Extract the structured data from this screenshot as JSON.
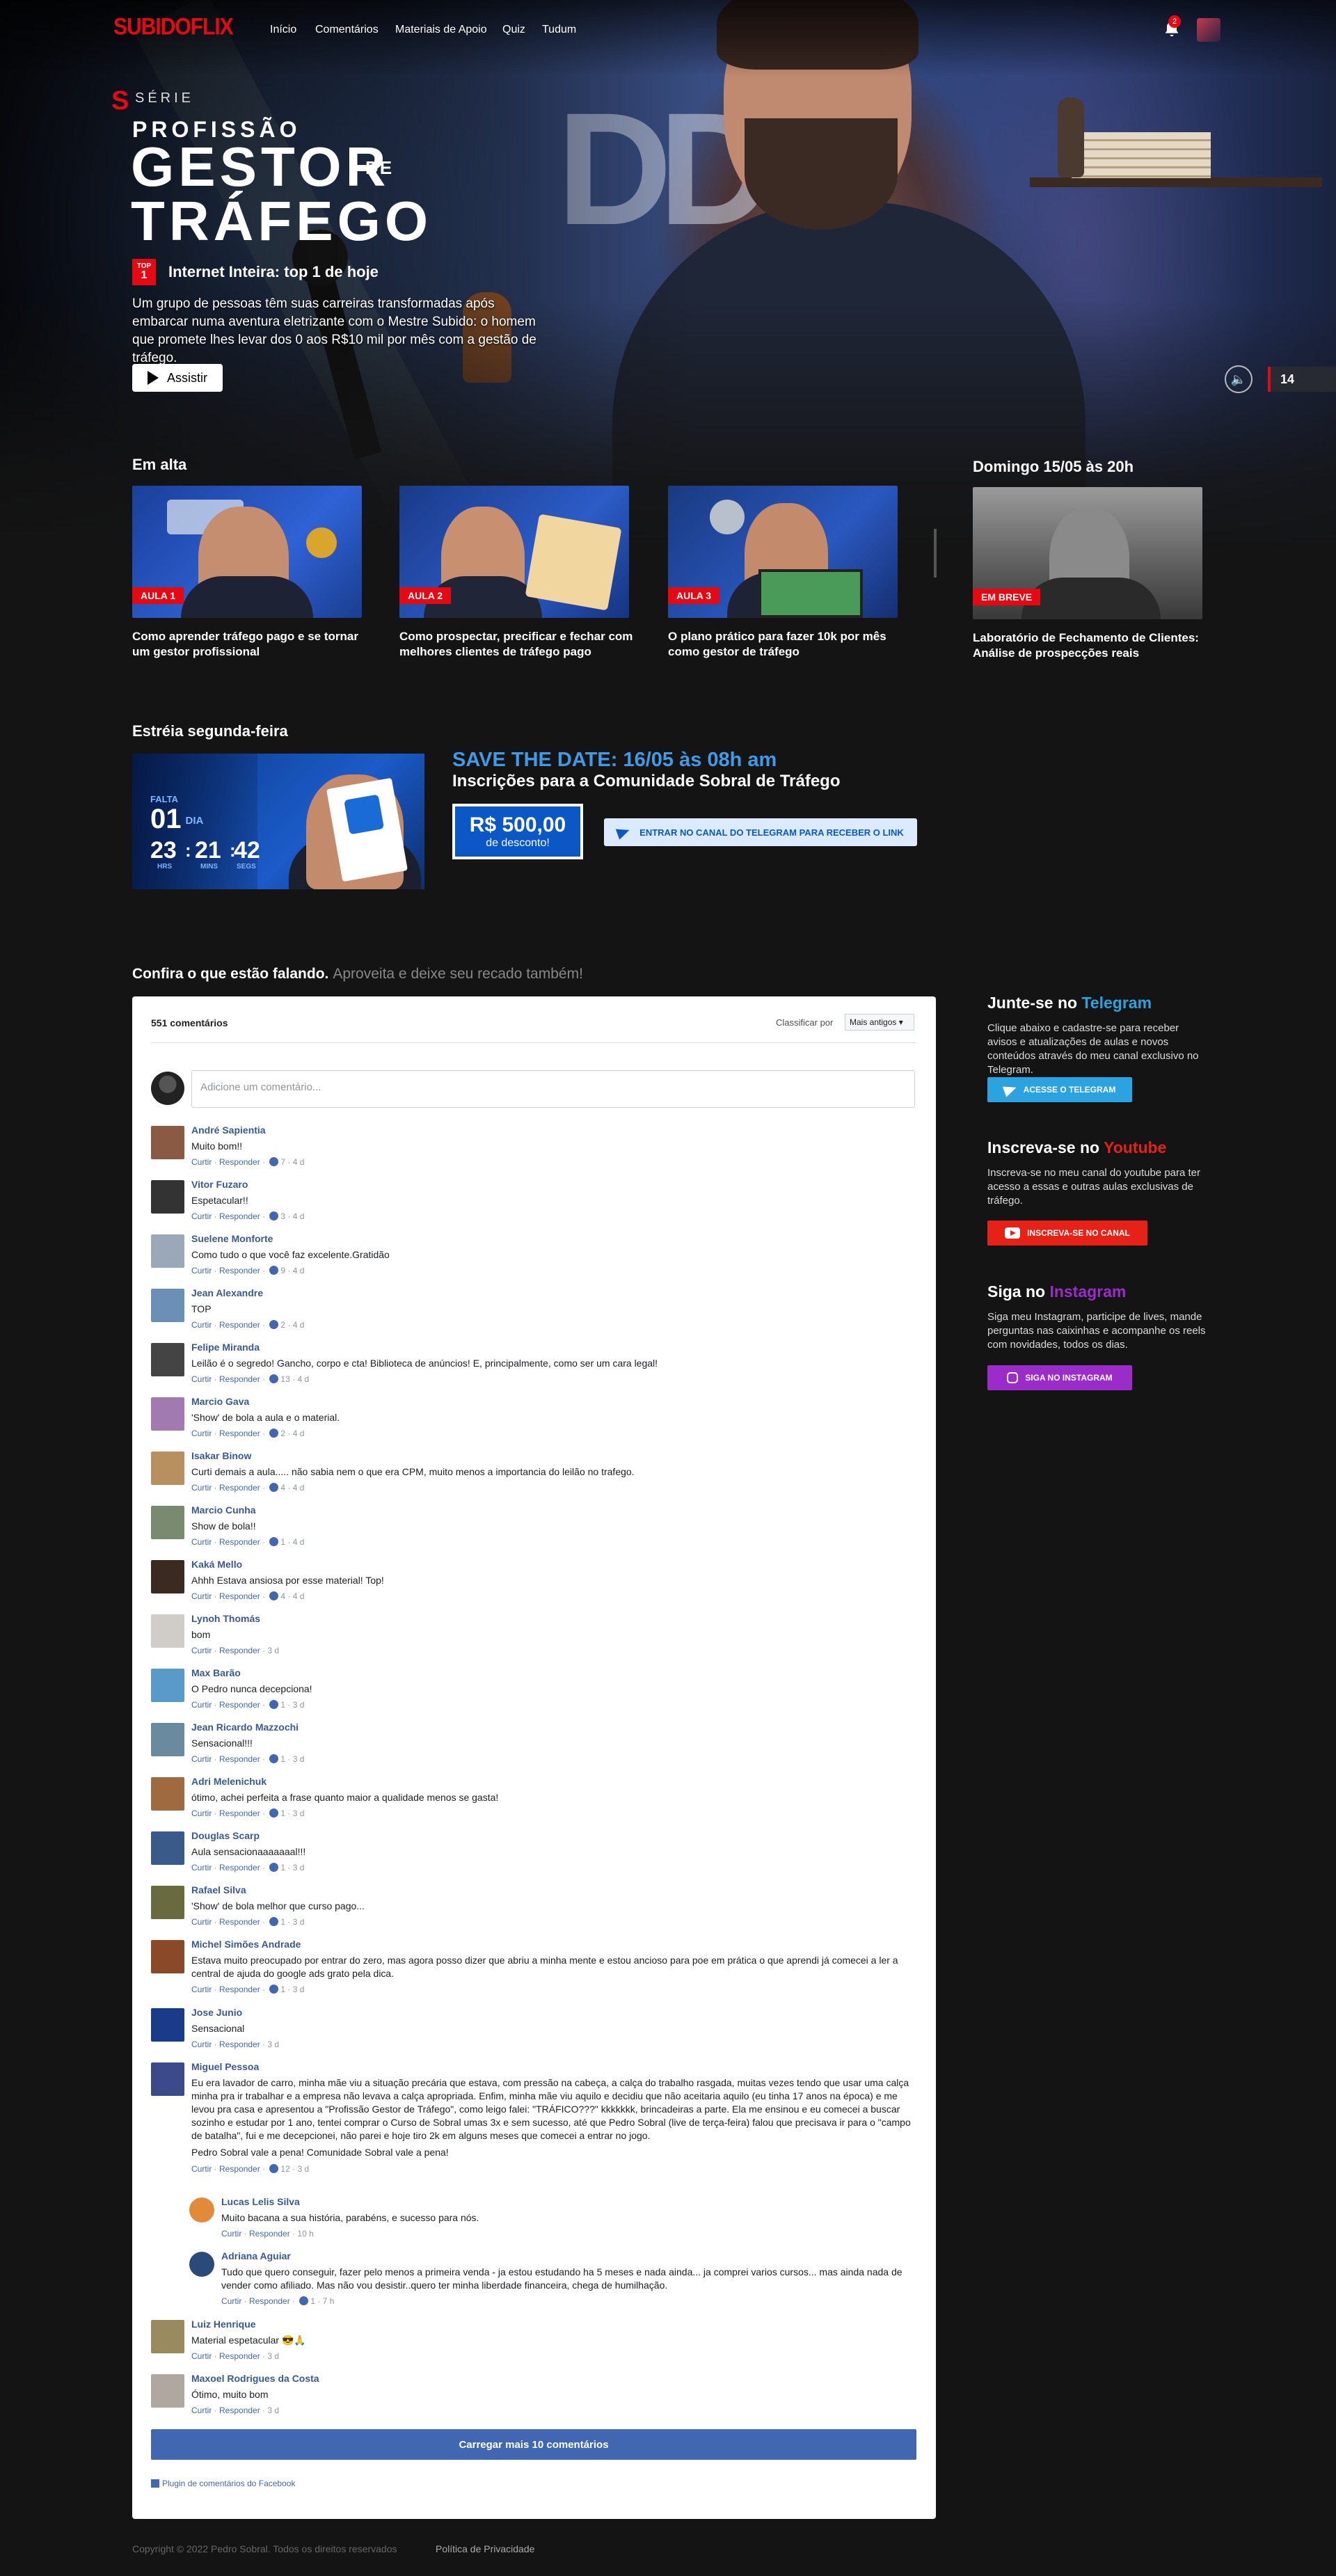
{
  "nav": {
    "logo": "SUBIDOFLIX",
    "links": [
      "Início",
      "Comentários",
      "Materiais de Apoio",
      "Quiz",
      "Tudum"
    ],
    "notifications": "2"
  },
  "hero": {
    "serie": "SÉRIE",
    "title_line1": "PROFISSÃO",
    "title_line2": "GESTOR",
    "title_de": "DE",
    "title_line3": "TRÁFEGO",
    "top_badge_top": "TOP",
    "top_badge_num": "1",
    "top_text": "Internet Inteira: top 1 de hoje",
    "synopsis": "Um grupo de pessoas têm suas carreiras transformadas após embarcar numa aventura eletrizante com o Mestre Subido: o homem que promete lhes levar dos 0 aos R$10 mil por mês com a gestão de tráfego.",
    "watch": "Assistir",
    "age": "14"
  },
  "em_alta": {
    "title": "Em alta",
    "cards": [
      {
        "tag": "AULA 1",
        "title": "Como aprender tráfego pago e se tornar um gestor profissional"
      },
      {
        "tag": "AULA 2",
        "title": "Como prospectar, precificar e fechar com melhores clientes de tráfego pago"
      },
      {
        "tag": "AULA 3",
        "title": "O plano prático para fazer 10k por mês como gestor de tráfego"
      }
    ]
  },
  "domingo": {
    "title": "Domingo 15/05 às 20h",
    "tag": "EM BREVE",
    "card_title": "Laboratório de Fechamento de Clientes: Análise de prospecções reais"
  },
  "estreia": {
    "title": "Estréia segunda-feira",
    "falta": "FALTA",
    "days": "01",
    "days_label": "DIA",
    "hrs": "23",
    "mins": "21",
    "segs": "42",
    "hrs_label": "HRS",
    "mins_label": "MINS",
    "segs_label": "SEGS",
    "save_date": "SAVE THE DATE: 16/05 às 08h am",
    "inscricoes": "Inscrições para a Comunidade Sobral de Tráfego",
    "price": "R$ 500,00",
    "discount": "de desconto!",
    "telegram_btn": "ENTRAR NO CANAL DO TELEGRAM PARA RECEBER O LINK"
  },
  "comments_section": {
    "heading": "Confira o que estão falando.",
    "subheading": "Aproveita e deixe seu recado também!",
    "count": "551 comentários",
    "sort_label": "Classificar por",
    "sort_value": "Mais antigos",
    "placeholder": "Adicione um comentário...",
    "load_more": "Carregar mais 10 comentários",
    "plugin": "Plugin de comentários do Facebook",
    "curtir": "Curtir",
    "responder": "Responder"
  },
  "comments": [
    {
      "name": "André Sapientia",
      "text": "Muito bom!!",
      "likes": "7",
      "time": "4 d",
      "color": "#8a5a44"
    },
    {
      "name": "Vitor Fuzaro",
      "text": "Espetacular!!",
      "likes": "3",
      "time": "4 d",
      "color": "#333333"
    },
    {
      "name": "Suelene Monforte",
      "text": "Como tudo o que você faz excelente.Gratidão",
      "likes": "9",
      "time": "4 d",
      "color": "#9aa8b8"
    },
    {
      "name": "Jean Alexandre",
      "text": "TOP",
      "likes": "2",
      "time": "4 d",
      "color": "#6b8fb5"
    },
    {
      "name": "Felipe Miranda",
      "text": "Leilão é o segredo! Gancho, corpo e cta! Biblioteca de anúncios! E, principalmente, como ser um cara legal!",
      "likes": "13",
      "time": "4 d",
      "color": "#444444"
    },
    {
      "name": "Marcio Gava",
      "text": "'Show' de bola a aula e o material.",
      "likes": "2",
      "time": "4 d",
      "color": "#a07ab0"
    },
    {
      "name": "Isakar Binow",
      "text": "Curti demais a aula..... não sabia nem o que era CPM, muito menos a importancia do leilão no trafego.",
      "likes": "4",
      "time": "4 d",
      "color": "#b89060"
    },
    {
      "name": "Marcio Cunha",
      "text": "Show de bola!!",
      "likes": "1",
      "time": "4 d",
      "color": "#7a8a70"
    },
    {
      "name": "Kaká Mello",
      "text": "Ahhh Estava ansiosa por esse material! Top!",
      "likes": "4",
      "time": "4 d",
      "color": "#3a2a20"
    },
    {
      "name": "Lynoh Thomás",
      "text": "bom",
      "likes": "",
      "time": "3 d",
      "color": "#d0ccc8"
    },
    {
      "name": "Max Barão",
      "text": "O Pedro nunca decepciona!",
      "likes": "1",
      "time": "3 d",
      "color": "#5a9ac8"
    },
    {
      "name": "Jean Ricardo Mazzochi",
      "text": "Sensacional!!!",
      "likes": "1",
      "time": "3 d",
      "color": "#6a8aa0"
    },
    {
      "name": "Adri Melenichuk",
      "text": "ótimo, achei perfeita a frase quanto maior a qualidade menos se gasta!",
      "likes": "1",
      "time": "3 d",
      "color": "#a06a40"
    },
    {
      "name": "Douglas Scarp",
      "text": "Aula sensacionaaaaaaal!!!",
      "likes": "1",
      "time": "3 d",
      "color": "#3a5a8a"
    },
    {
      "name": "Rafael Silva",
      "text": "'Show' de bola melhor que curso pago...",
      "likes": "1",
      "time": "3 d",
      "color": "#6a6a40"
    },
    {
      "name": "Michel Simões Andrade",
      "text": "Estava muito preocupado por entrar do zero, mas agora posso dizer que abriu a minha mente e estou ancioso para poe em prática o que aprendi já comecei a ler a central de ajuda do google ads grato pela dica.",
      "likes": "1",
      "time": "3 d",
      "color": "#8a4a2a"
    },
    {
      "name": "Jose Junio",
      "text": "Sensacional",
      "likes": "",
      "time": "3 d",
      "color": "#1a3a8a"
    },
    {
      "name": "Miguel Pessoa",
      "text": "Eu era lavador de carro, minha mãe viu a situação precária que estava, com pressão na cabeça, a calça do trabalho rasgada, muitas vezes tendo que usar uma calça minha pra ir trabalhar e a empresa não levava a calça apropriada. Enfim, minha mãe viu aquilo e decidiu que não aceitaria aquilo (eu tinha 17 anos na época) e me levou pra casa e apresentou a \"Profissão Gestor de Tráfego\", como leigo falei: \"TRÁFICO???\" kkkkkkk, brincadeiras a parte. Ela me ensinou e eu comecei a buscar sozinho e estudar por 1 ano, tentei comprar o Curso de Sobral umas 3x e sem sucesso, até que Pedro Sobral (live de terça-feira) falou que precisava ir para o \"campo de batalha\", fui e me decepcionei, não parei e hoje tiro 2k em alguns meses que comecei a entrar no jogo.",
      "text2": "Pedro Sobral vale a pena! Comunidade Sobral vale a pena!",
      "likes": "12",
      "time": "3 d",
      "color": "#3a4a8a"
    },
    {
      "name": "Lucas Lelis Silva",
      "text": "Muito bacana a sua história, parabéns, e sucesso para nós.",
      "likes": "",
      "time": "10 h",
      "color": "#e08a3a"
    },
    {
      "name": "Adriana Aguiar",
      "text": "Tudo que quero conseguir, fazer pelo menos a primeira venda - ja estou estudando ha 5 meses e nada ainda... ja comprei varios cursos... mas ainda nada de vender como afiliado. Mas não vou desistir..quero ter minha liberdade financeira, chega de humilhação.",
      "likes": "1",
      "time": "7 h",
      "color": "#2a4a7a"
    },
    {
      "name": "Luiz Henrique",
      "text": "Material espetacular 😎🙏",
      "likes": "",
      "time": "3 d",
      "color": "#9a8a60"
    },
    {
      "name": "Maxoel Rodrigues da Costa",
      "text": "Ótimo, muito bom",
      "likes": "",
      "time": "3 d",
      "color": "#b0a8a0"
    }
  ],
  "sidebar": {
    "telegram": {
      "prefix": "Junte-se no",
      "brand": "Telegram",
      "text": "Clique abaixo e cadastre-se para receber avisos e atualizações de aulas e novos conteúdos através do meu canal exclusivo no Telegram.",
      "btn": "ACESSE O TELEGRAM",
      "color": "#2aa3e0"
    },
    "youtube": {
      "prefix": "Inscreva-se no",
      "brand": "Youtube",
      "text": "Inscreva-se no meu canal do youtube para ter acesso a essas e outras aulas exclusivas de tráfego.",
      "btn": "INSCREVA-SE NO CANAL",
      "color": "#e62117"
    },
    "instagram": {
      "prefix": "Siga no",
      "brand": "Instagram",
      "text": "Siga meu Instagram, participe de lives, mande perguntas nas caixinhas e acompanhe os reels com novidades, todos os dias.",
      "btn": "SIGA NO INSTAGRAM",
      "color": "#9b2cc9"
    }
  },
  "footer": {
    "copyright": "Copyright © 2022 Pedro Sobral. Todos os direitos reservados",
    "privacy": "Política de Privacidade"
  }
}
